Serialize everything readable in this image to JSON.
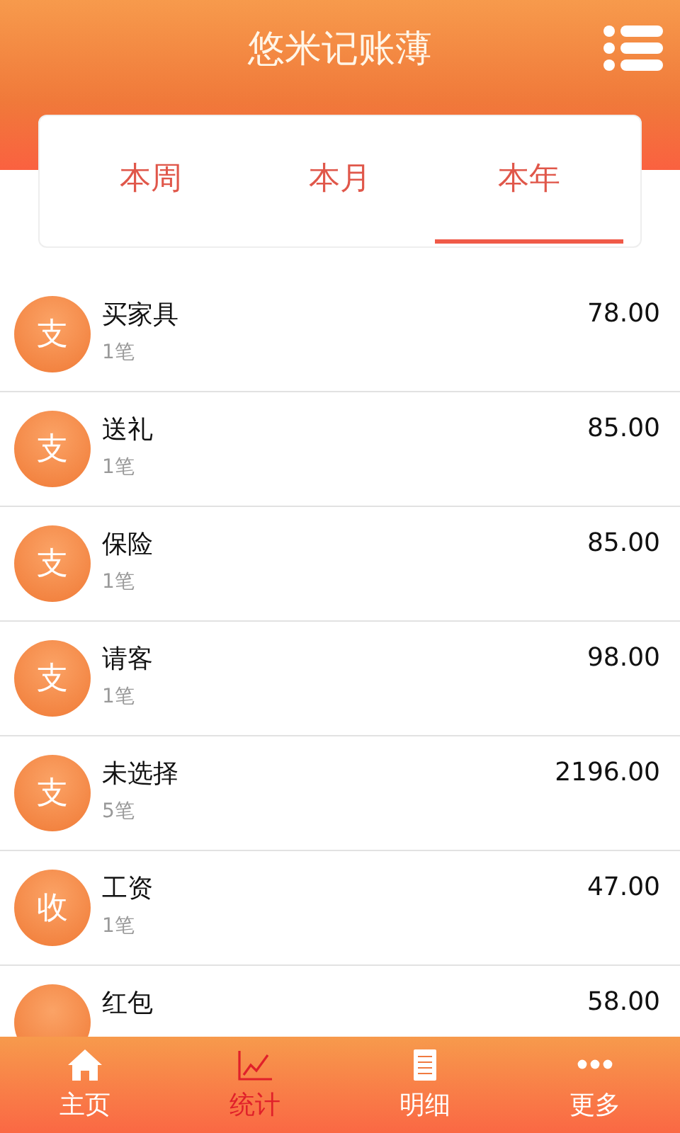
{
  "app_title": "悠米记账薄",
  "tabs": [
    {
      "label": "本周",
      "selected": false
    },
    {
      "label": "本月",
      "selected": false
    },
    {
      "label": "本年",
      "selected": true
    }
  ],
  "entries": [
    {
      "badge": "支",
      "name": "买家具",
      "count": "1笔",
      "amount": "78.00"
    },
    {
      "badge": "支",
      "name": "送礼",
      "count": "1笔",
      "amount": "85.00"
    },
    {
      "badge": "支",
      "name": "保险",
      "count": "1笔",
      "amount": "85.00"
    },
    {
      "badge": "支",
      "name": "请客",
      "count": "1笔",
      "amount": "98.00"
    },
    {
      "badge": "支",
      "name": "未选择",
      "count": "5笔",
      "amount": "2196.00"
    },
    {
      "badge": "收",
      "name": "工资",
      "count": "1笔",
      "amount": "47.00"
    },
    {
      "name": "红包",
      "amount": "58.00"
    }
  ],
  "nav": [
    {
      "kind": "home",
      "label": "主页",
      "selected": false
    },
    {
      "kind": "chart",
      "label": "统计",
      "selected": true
    },
    {
      "kind": "document",
      "label": "明细",
      "selected": false
    },
    {
      "kind": "more",
      "label": "更多",
      "selected": false
    }
  ]
}
